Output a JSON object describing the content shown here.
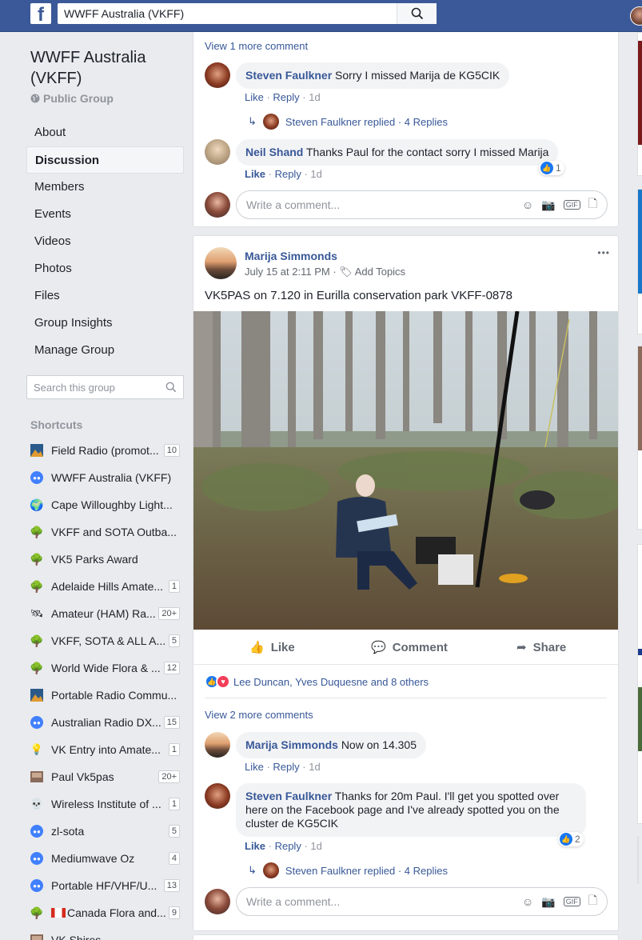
{
  "topbar": {
    "search_value": "WWFF Australia (VKFF)",
    "logo_letter": "f"
  },
  "sidebar": {
    "group_name": "WWFF Australia (VKFF)",
    "group_type": "Public Group",
    "nav": [
      "About",
      "Discussion",
      "Members",
      "Events",
      "Videos",
      "Photos",
      "Files",
      "Group Insights",
      "Manage Group"
    ],
    "active_nav": "Discussion",
    "search_placeholder": "Search this group",
    "shortcuts_title": "Shortcuts",
    "shortcuts": [
      {
        "label": "Field Radio (promot...",
        "badge": "10",
        "icon": "landscape-icon"
      },
      {
        "label": "WWFF Australia (VKFF)",
        "badge": "",
        "icon": "group-icon"
      },
      {
        "label": "Cape Willoughby Light...",
        "badge": "",
        "icon": "globe-icon"
      },
      {
        "label": "VKFF and SOTA Outba...",
        "badge": "",
        "icon": "tree-icon"
      },
      {
        "label": "VK5 Parks Award",
        "badge": "",
        "icon": "tree-icon"
      },
      {
        "label": "Adelaide Hills Amate...",
        "badge": "1",
        "icon": "tree-icon"
      },
      {
        "label": "Amateur (HAM) Ra...",
        "badge": "20+",
        "icon": "satellite-icon"
      },
      {
        "label": "VKFF, SOTA & ALL A...",
        "badge": "5",
        "icon": "tree-icon"
      },
      {
        "label": "World Wide Flora & ...",
        "badge": "12",
        "icon": "tree-icon"
      },
      {
        "label": "Portable Radio Commu...",
        "badge": "",
        "icon": "landscape-icon"
      },
      {
        "label": "Australian Radio DX...",
        "badge": "15",
        "icon": "group-icon"
      },
      {
        "label": "VK Entry into Amate...",
        "badge": "1",
        "icon": "bulb-icon"
      },
      {
        "label": "Paul Vk5pas",
        "badge": "20+",
        "icon": "photo-icon"
      },
      {
        "label": "Wireless Institute of ...",
        "badge": "1",
        "icon": "skull-icon"
      },
      {
        "label": "zl-sota",
        "badge": "5",
        "icon": "group-icon"
      },
      {
        "label": "Mediumwave Oz",
        "badge": "4",
        "icon": "group-icon"
      },
      {
        "label": "Portable HF/VHF/U...",
        "badge": "13",
        "icon": "group-icon"
      },
      {
        "label": "Canada Flora and...",
        "badge": "9",
        "icon": "tree-icon"
      },
      {
        "label": "VK Shires",
        "badge": "",
        "icon": "photo-icon"
      }
    ]
  },
  "post1": {
    "view_more": "View 1 more comment",
    "comments": [
      {
        "author": "Steven Faulkner",
        "text": "Sorry I missed Marija de KG5CIK",
        "like": "Like",
        "reply": "Reply",
        "age": "1d"
      },
      {
        "author": "Neil Shand",
        "text": "Thanks Paul for the contact sorry I missed Marija",
        "like": "Like",
        "reply": "Reply",
        "age": "1d",
        "reactions": "1"
      }
    ],
    "replies_line": "Steven Faulkner replied · 4 Replies",
    "write_placeholder": "Write a comment..."
  },
  "post2": {
    "author": "Marija Simmonds",
    "time": "July 15 at 2:11 PM",
    "add_topics": "Add Topics",
    "more": "•••",
    "text": "VK5PAS on 7.120 in Eurilla conservation park VKFF-0878",
    "actions": {
      "like": "Like",
      "comment": "Comment",
      "share": "Share"
    },
    "reactions_text": "Lee Duncan, Yves Duquesne and 8 others",
    "view_more": "View 2 more comments",
    "comments": [
      {
        "author": "Marija Simmonds",
        "text": "Now on 14.305",
        "like": "Like",
        "reply": "Reply",
        "age": "1d"
      },
      {
        "author": "Steven Faulkner",
        "text_line1": "Thanks for 20m Paul. I'll get you spotted over",
        "text_line2": "here on the Facebook page and I've already spotted you on the",
        "text_line3": "cluster de KG5CIK",
        "like": "Like",
        "reply": "Reply",
        "age": "1d",
        "reactions": "2"
      }
    ],
    "replies_line": "Steven Faulkner replied · 4 Replies",
    "write_placeholder": "Write a comment..."
  },
  "colors": {
    "brand": "#3b5998",
    "link": "#385898",
    "bg": "#e9ebee"
  }
}
